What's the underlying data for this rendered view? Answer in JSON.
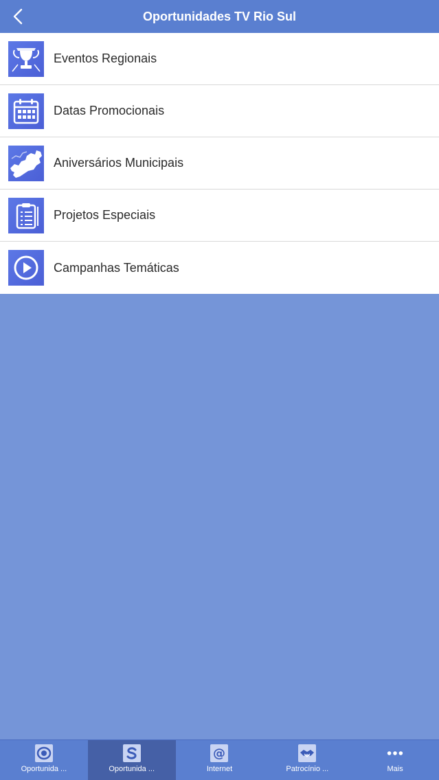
{
  "header": {
    "title": "Oportunidades TV Rio Sul"
  },
  "menu": {
    "items": [
      {
        "label": "Eventos Regionais",
        "icon": "trophy-icon"
      },
      {
        "label": "Datas Promocionais",
        "icon": "calendar-icon"
      },
      {
        "label": "Aniversários Municipais",
        "icon": "map-icon"
      },
      {
        "label": "Projetos Especiais",
        "icon": "clipboard-icon"
      },
      {
        "label": "Campanhas Temáticas",
        "icon": "play-icon"
      }
    ]
  },
  "tabbar": {
    "tabs": [
      {
        "label": "Oportunida ...",
        "icon": "tv-logo-icon",
        "active": false
      },
      {
        "label": "Oportunida ...",
        "icon": "s-logo-icon",
        "active": true
      },
      {
        "label": "Internet",
        "icon": "at-icon",
        "active": false
      },
      {
        "label": "Patrocínio ...",
        "icon": "handshake-icon",
        "active": false
      },
      {
        "label": "Mais",
        "icon": "more-icon",
        "active": false
      }
    ]
  },
  "colors": {
    "navbar": "#5a7fd0",
    "background": "#7595d8",
    "icon_tile": "#4b5fd6",
    "tab_active": "#4560a6"
  }
}
